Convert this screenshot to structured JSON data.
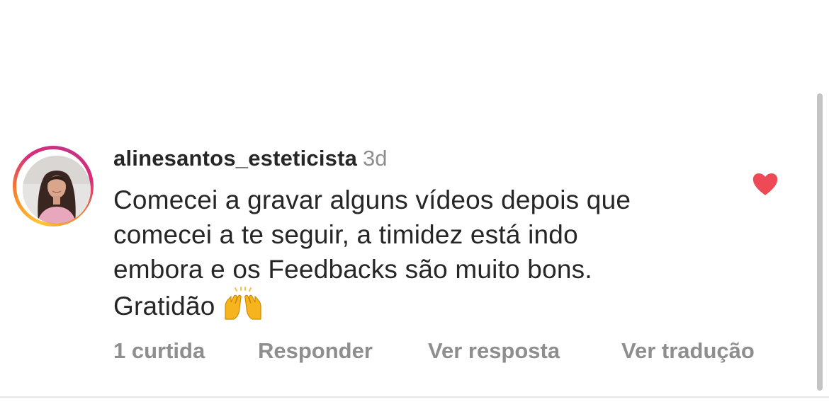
{
  "comment": {
    "username": "alinesantos_esteticista",
    "time": "3d",
    "text_lines": [
      "Comecei a gravar alguns vídeos depois que",
      "comecei a te seguir, a timidez está indo",
      "embora e os Feedbacks são muito bons.",
      "Gratidão"
    ],
    "emoji": "raising-hands-icon",
    "liked": true,
    "like_color": "#ed4956",
    "actions": {
      "likes": "1 curtida",
      "reply": "Responder",
      "view_reply": "Ver resposta",
      "translate": "Ver tradução"
    }
  },
  "colors": {
    "text": "#262626",
    "secondary": "#8e8e8e",
    "story_ring": [
      "#fdc83a",
      "#f58529",
      "#dd2a7b",
      "#c13584"
    ]
  }
}
